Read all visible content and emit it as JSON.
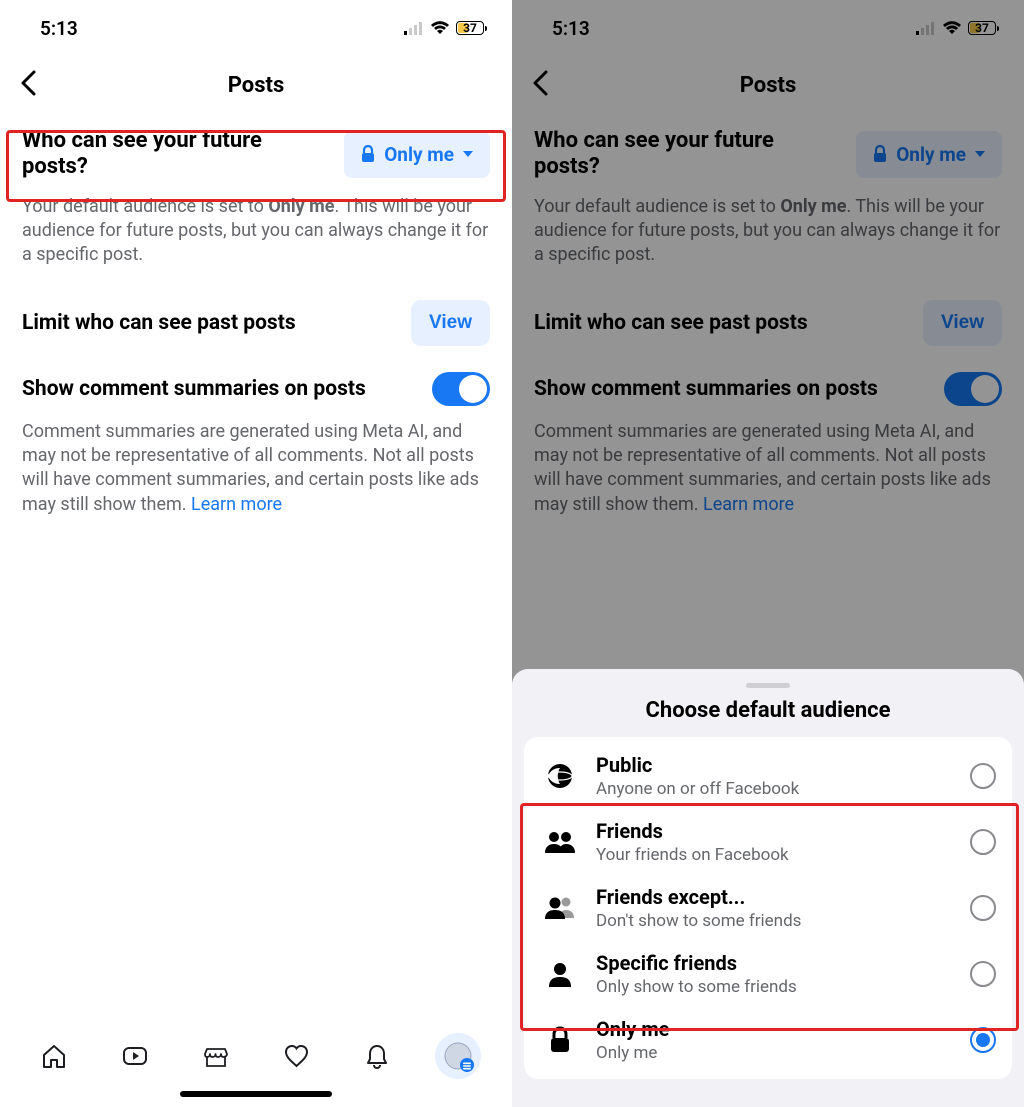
{
  "statusbar": {
    "time": "5:13",
    "battery_percent": "37"
  },
  "nav": {
    "title": "Posts"
  },
  "future": {
    "heading": "Who can see your future posts?",
    "audience_label": "Only me",
    "desc_pre": "Your default audience is set to ",
    "desc_bold": "Only me",
    "desc_post": ". This will be your audience for future posts, but you can always change it for a specific post."
  },
  "limit": {
    "label": "Limit who can see past posts",
    "button": "View"
  },
  "summaries": {
    "label": "Show comment summaries on posts",
    "desc": "Comment summaries are generated using Meta AI, and may not be representative of all comments. Not all posts will have comment summaries, and certain posts like ads may still show them. ",
    "learn_more": "Learn more"
  },
  "sheet": {
    "title": "Choose default audience",
    "options": [
      {
        "title": "Public",
        "sub": "Anyone on or off Facebook",
        "icon": "globe",
        "selected": false
      },
      {
        "title": "Friends",
        "sub": "Your friends on Facebook",
        "icon": "friends",
        "selected": false
      },
      {
        "title": "Friends except...",
        "sub": "Don't show to some friends",
        "icon": "friends-except",
        "selected": false
      },
      {
        "title": "Specific friends",
        "sub": "Only show to some friends",
        "icon": "person",
        "selected": false
      },
      {
        "title": "Only me",
        "sub": "Only me",
        "icon": "lock",
        "selected": true
      }
    ]
  },
  "colors": {
    "accent": "#1877f2",
    "muted": "#65676b",
    "highlight": "#e02424",
    "battery": "#f7c948"
  }
}
